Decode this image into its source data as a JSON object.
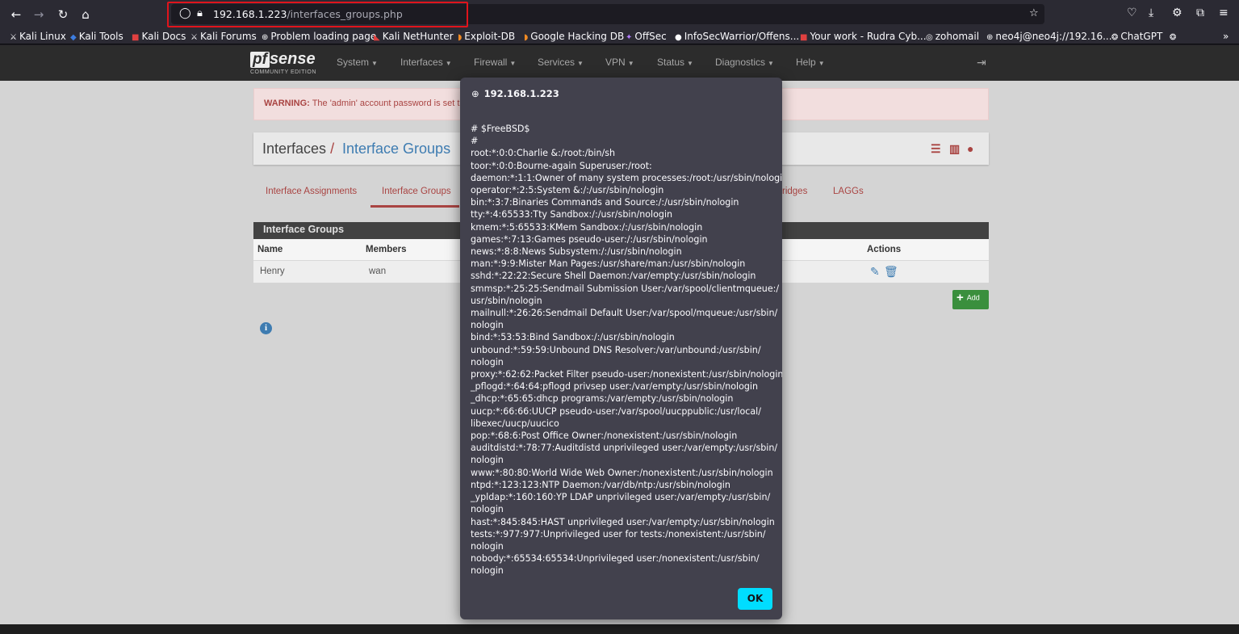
{
  "browser": {
    "url_host": "192.168.1.223",
    "url_path": "/interfaces_groups.php",
    "bookmarks": [
      {
        "icon": "kali-icon",
        "label": "Kali Linux"
      },
      {
        "icon": "kali-tools-icon",
        "label": "Kali Tools"
      },
      {
        "icon": "kali-docs-icon",
        "label": "Kali Docs"
      },
      {
        "icon": "kali-forums-icon",
        "label": "Kali Forums"
      },
      {
        "icon": "globe-icon",
        "label": "Problem loading page"
      },
      {
        "icon": "nethunter-icon",
        "label": "Kali NetHunter"
      },
      {
        "icon": "exploit-db-icon",
        "label": "Exploit-DB"
      },
      {
        "icon": "ghdb-icon",
        "label": "Google Hacking DB"
      },
      {
        "icon": "offsec-icon",
        "label": "OffSec"
      },
      {
        "icon": "github-icon",
        "label": "InfoSecWarrior/Offens..."
      },
      {
        "icon": "jira-icon",
        "label": "Your work - Rudra Cyb..."
      },
      {
        "icon": "zoho-icon",
        "label": "zohomail"
      },
      {
        "icon": "globe-icon",
        "label": "neo4j@neo4j://192.16..."
      },
      {
        "icon": "chatgpt-icon",
        "label": "ChatGPT"
      }
    ],
    "overflow_label": "»"
  },
  "pfsense": {
    "logo_pf": "pf",
    "logo_sense": "sense",
    "logo_edition": "COMMUNITY EDITION",
    "menu": [
      "System",
      "Interfaces",
      "Firewall",
      "Services",
      "VPN",
      "Status",
      "Diagnostics",
      "Help"
    ],
    "warning_label": "WARNING:",
    "warning_text": "The 'admin' account password is set t",
    "breadcrumb_first": "Interfaces",
    "breadcrumb_sep": "/",
    "breadcrumb_second": "Interface Groups",
    "tabs": [
      "Interface Assignments",
      "Interface Groups",
      "ridges",
      "LAGGs"
    ],
    "panel_title": "Interface Groups",
    "columns": [
      "Name",
      "Members",
      "Actions"
    ],
    "rows": [
      {
        "name": "Henry",
        "members": "wan"
      }
    ],
    "add_label": "Add"
  },
  "dialog": {
    "title": "192.168.1.223",
    "ok_label": "OK",
    "lines": [
      "# $FreeBSD$",
      "#",
      "root:*:0:0:Charlie &:/root:/bin/sh",
      "toor:*:0:0:Bourne-again Superuser:/root:",
      "daemon:*:1:1:Owner of many system processes:/root:/usr/sbin/nologin",
      "operator:*:2:5:System &:/:/usr/sbin/nologin",
      "bin:*:3:7:Binaries Commands and Source:/:/usr/sbin/nologin",
      "tty:*:4:65533:Tty Sandbox:/:/usr/sbin/nologin",
      "kmem:*:5:65533:KMem Sandbox:/:/usr/sbin/nologin",
      "games:*:7:13:Games pseudo-user:/:/usr/sbin/nologin",
      "news:*:8:8:News Subsystem:/:/usr/sbin/nologin",
      "man:*:9:9:Mister Man Pages:/usr/share/man:/usr/sbin/nologin",
      "sshd:*:22:22:Secure Shell Daemon:/var/empty:/usr/sbin/nologin",
      "smmsp:*:25:25:Sendmail Submission User:/var/spool/clientmqueue:/",
      "usr/sbin/nologin",
      "mailnull:*:26:26:Sendmail Default User:/var/spool/mqueue:/usr/sbin/",
      "nologin",
      "bind:*:53:53:Bind Sandbox:/:/usr/sbin/nologin",
      "unbound:*:59:59:Unbound DNS Resolver:/var/unbound:/usr/sbin/",
      "nologin",
      "proxy:*:62:62:Packet Filter pseudo-user:/nonexistent:/usr/sbin/nologin",
      "_pflogd:*:64:64:pflogd privsep user:/var/empty:/usr/sbin/nologin",
      "_dhcp:*:65:65:dhcp programs:/var/empty:/usr/sbin/nologin",
      "uucp:*:66:66:UUCP pseudo-user:/var/spool/uucppublic:/usr/local/",
      "libexec/uucp/uucico",
      "pop:*:68:6:Post Office Owner:/nonexistent:/usr/sbin/nologin",
      "auditdistd:*:78:77:Auditdistd unprivileged user:/var/empty:/usr/sbin/",
      "nologin",
      "www:*:80:80:World Wide Web Owner:/nonexistent:/usr/sbin/nologin",
      "ntpd:*:123:123:NTP Daemon:/var/db/ntp:/usr/sbin/nologin",
      "_ypldap:*:160:160:YP LDAP unprivileged user:/var/empty:/usr/sbin/",
      "nologin",
      "hast:*:845:845:HAST unprivileged user:/var/empty:/usr/sbin/nologin",
      "tests:*:977:977:Unprivileged user for tests:/nonexistent:/usr/sbin/",
      "nologin",
      "nobody:*:65534:65534:Unprivileged user:/nonexistent:/usr/sbin/",
      "nologin"
    ]
  }
}
